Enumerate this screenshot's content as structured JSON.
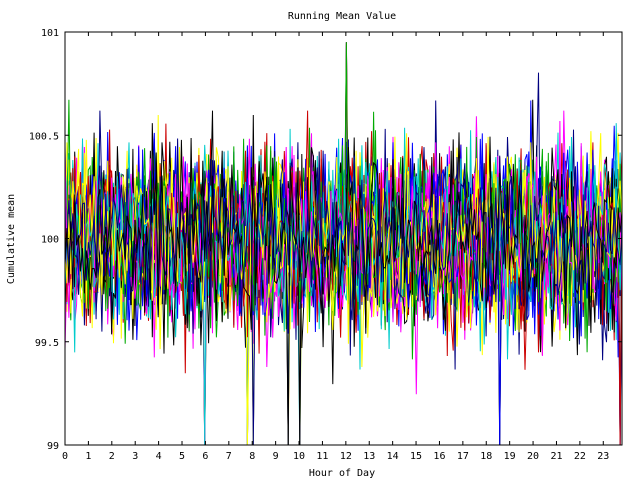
{
  "chart_data": {
    "type": "line",
    "title": "Running Mean Value",
    "xlabel": "Hour of Day",
    "ylabel": "Cumulative mean",
    "xlim": [
      0,
      23.8
    ],
    "ylim": [
      99,
      101
    ],
    "x_ticks": [
      0,
      1,
      2,
      3,
      4,
      5,
      6,
      7,
      8,
      9,
      10,
      11,
      12,
      13,
      14,
      15,
      16,
      17,
      18,
      19,
      20,
      21,
      22,
      23
    ],
    "x_tick_labels": [
      "0",
      "1",
      "2",
      "3",
      "4",
      "5",
      "6",
      "7",
      "8",
      "9",
      "10",
      "11",
      "12",
      "13",
      "14",
      "15",
      "16",
      "17",
      "18",
      "19",
      "20",
      "21",
      "22",
      "23"
    ],
    "y_ticks": [
      99,
      99.5,
      100,
      100.5,
      101
    ],
    "y_tick_labels": [
      "99",
      "99.5",
      "100",
      "100.5",
      "101"
    ],
    "grid": false,
    "legend": "none",
    "series_count": 40,
    "samples_per_series": 288,
    "central_value": 100,
    "typical_spread": 0.25,
    "visible_range": [
      99,
      101
    ],
    "colors": [
      "#0000ff",
      "#cc0000",
      "#00aa00",
      "#ff00ff",
      "#00cccc",
      "#ffff00",
      "#000080",
      "#000000"
    ],
    "notable_excursions": [
      {
        "x": 6.0,
        "y": 99.0
      },
      {
        "x": 7.8,
        "y": 99.0
      },
      {
        "x": 8.05,
        "y": 99.0
      },
      {
        "x": 9.55,
        "y": 99.0
      },
      {
        "x": 10.0,
        "y": 99.0
      },
      {
        "x": 18.55,
        "y": 99.0
      },
      {
        "x": 23.7,
        "y": 99.0
      },
      {
        "x": 12.0,
        "y": 100.95
      },
      {
        "x": 23.9,
        "y": 100.85
      }
    ]
  }
}
